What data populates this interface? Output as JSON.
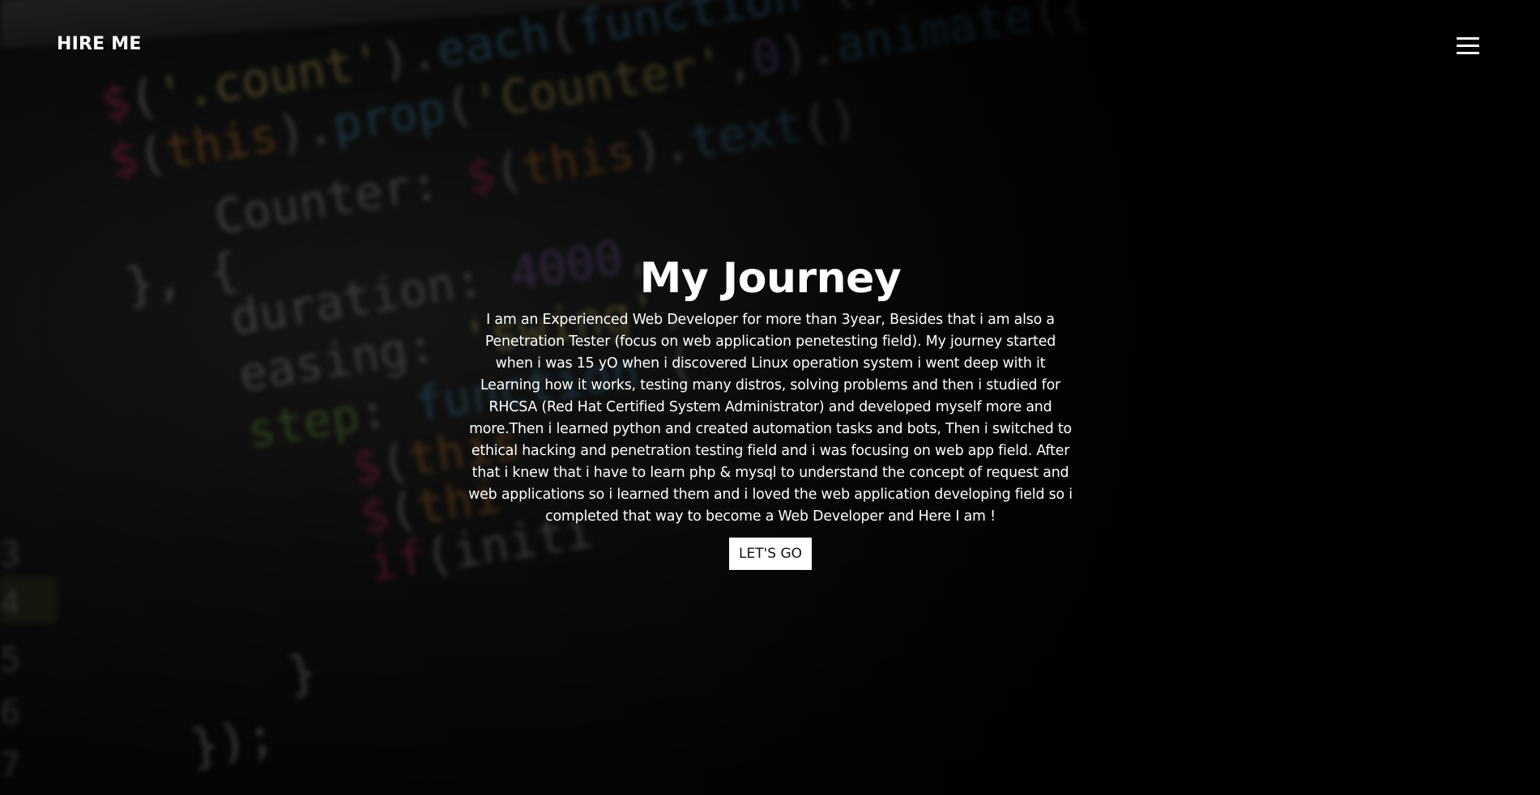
{
  "header": {
    "brand": "HIRE ME",
    "menu_icon": "hamburger-menu-icon"
  },
  "hero": {
    "title": "My Journey",
    "description": "I am an Experienced Web Developer for more than 3year, Besides that i am also a Penetration Tester (focus on web application penetesting field). My journey started when i was 15 yO when i discovered Linux operation system i went deep with it Learning how it works, testing many distros, solving problems and then i studied for RHCSA (Red Hat Certified System Administrator) and developed myself more and more.Then i learned python and created automation tasks and bots, Then i switched to ethical hacking and penetration testing field and i was focusing on web app field. After that i knew that i have to learn php & mysql to understand the concept of request and web applications so i learned them and i loved the web application developing field so i completed that way to become a Web Developer and Here I am !",
    "cta_label": "LET'S GO"
  },
  "background": {
    "code_lines": [
      "$('.count').each(function () {",
      "$(this).prop('Counter',0).animate({",
      "Counter: $(this).text()",
      "}, {",
      "duration: 4000,",
      "easing: 'swing',",
      "step: function (",
      "$(this",
      "$(thi",
      "if(initi",
      "}",
      "});"
    ],
    "gutter_numbers": [
      "3",
      "4",
      "5",
      "6",
      "7"
    ],
    "colors": {
      "page": "#070707",
      "text": "#ffffff",
      "button_bg": "#ffffff",
      "button_text": "#111111"
    }
  }
}
